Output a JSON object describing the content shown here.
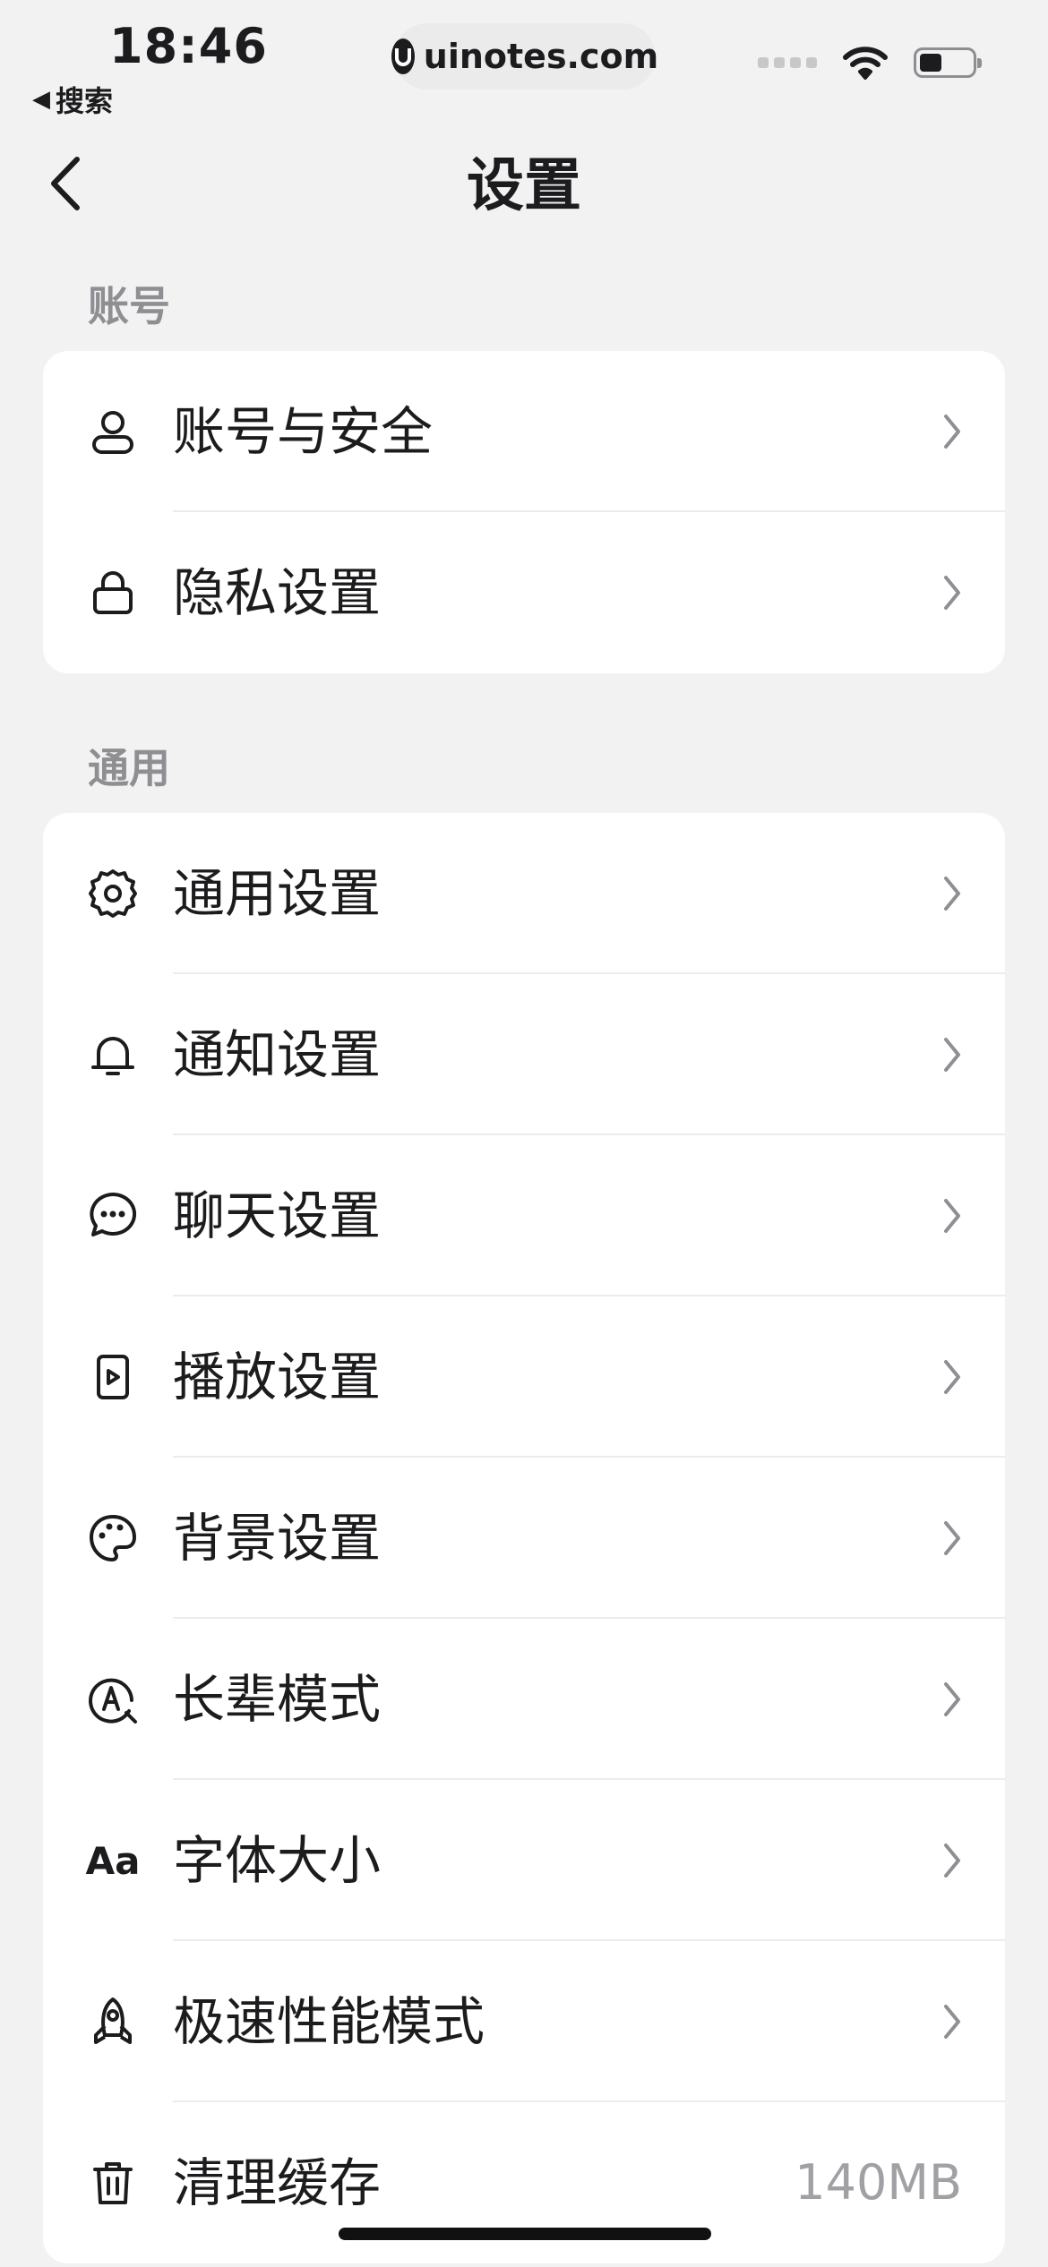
{
  "status_bar": {
    "time": "18:46",
    "back_app": "搜索",
    "url": "uinotes.com"
  },
  "nav": {
    "title": "设置"
  },
  "sections": [
    {
      "label": "账号",
      "items": [
        {
          "label": "账号与安全",
          "icon": "user-icon"
        },
        {
          "label": "隐私设置",
          "icon": "lock-icon"
        }
      ]
    },
    {
      "label": "通用",
      "items": [
        {
          "label": "通用设置",
          "icon": "gear-icon"
        },
        {
          "label": "通知设置",
          "icon": "bell-icon"
        },
        {
          "label": "聊天设置",
          "icon": "chat-bubble-icon"
        },
        {
          "label": "播放设置",
          "icon": "play-icon"
        },
        {
          "label": "背景设置",
          "icon": "palette-icon"
        },
        {
          "label": "长辈模式",
          "icon": "elder-mode-icon"
        },
        {
          "label": "字体大小",
          "icon": "font-size-icon",
          "icon_text": "Aa"
        },
        {
          "label": "极速性能模式",
          "icon": "rocket-icon"
        },
        {
          "label": "清理缓存",
          "icon": "trash-icon",
          "value": "140MB"
        }
      ]
    }
  ]
}
